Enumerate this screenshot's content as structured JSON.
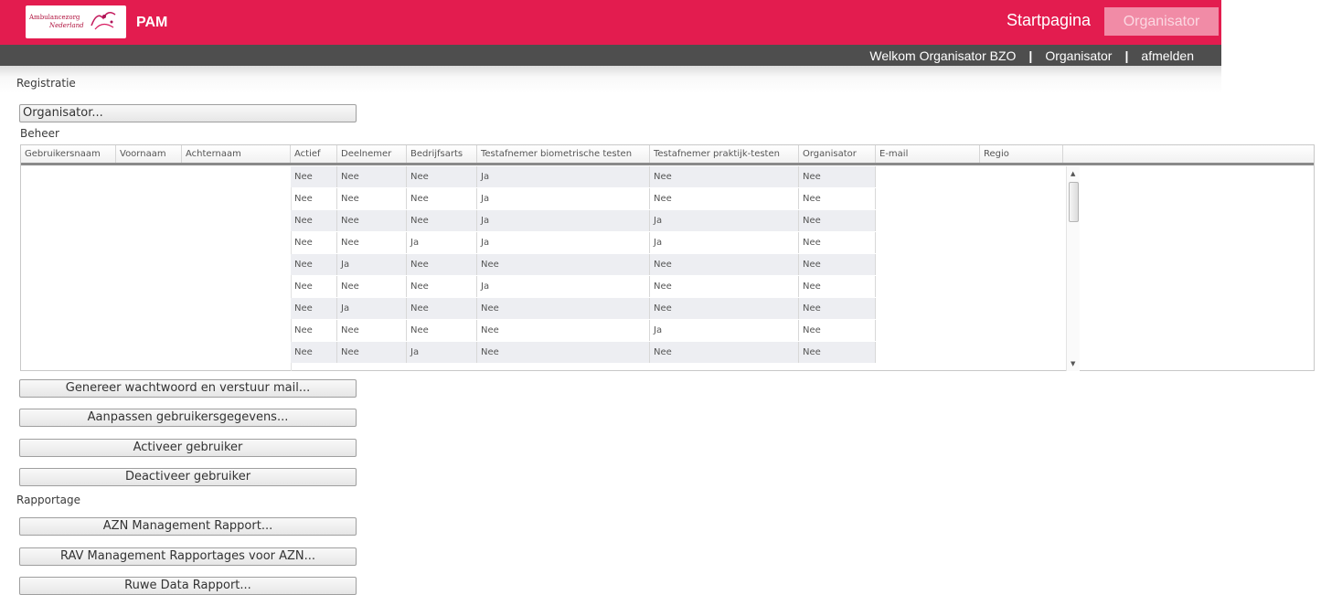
{
  "header": {
    "logo_line1": "Ambulancezorg",
    "logo_line2": "Nederland",
    "app_title": "PAM",
    "startpagina": "Startpagina",
    "role_button": "Organisator",
    "welcome": "Welkom Organisator BZO",
    "role_link": "Organisator",
    "logout": "afmelden",
    "brand_color": "#e31c4f"
  },
  "registratie": {
    "title": "Registratie",
    "organisator_button": "Organisator..."
  },
  "beheer": {
    "title": "Beheer",
    "columns": [
      "Gebruikersnaam",
      "Voornaam",
      "Achternaam",
      "Actief",
      "Deelnemer",
      "Bedrijfsarts",
      "Testafnemer biometrische testen",
      "Testafnemer praktijk-testen",
      "Organisator",
      "E-mail",
      "Regio"
    ],
    "rows": [
      [
        "Nee",
        "Nee",
        "Nee",
        "Ja",
        "Nee",
        "Nee"
      ],
      [
        "Nee",
        "Nee",
        "Nee",
        "Ja",
        "Nee",
        "Nee"
      ],
      [
        "Nee",
        "Nee",
        "Nee",
        "Ja",
        "Ja",
        "Nee"
      ],
      [
        "Nee",
        "Nee",
        "Ja",
        "Ja",
        "Ja",
        "Nee"
      ],
      [
        "Nee",
        "Ja",
        "Nee",
        "Nee",
        "Nee",
        "Nee"
      ],
      [
        "Nee",
        "Nee",
        "Nee",
        "Ja",
        "Nee",
        "Nee"
      ],
      [
        "Nee",
        "Ja",
        "Nee",
        "Nee",
        "Nee",
        "Nee"
      ],
      [
        "Nee",
        "Nee",
        "Nee",
        "Nee",
        "Ja",
        "Nee"
      ],
      [
        "Nee",
        "Nee",
        "Ja",
        "Nee",
        "Nee",
        "Nee"
      ]
    ],
    "buttons": {
      "generate": "Genereer wachtwoord en verstuur mail...",
      "edit": "Aanpassen gebruikersgegevens...",
      "activate": "Activeer gebruiker",
      "deactivate": "Deactiveer gebruiker"
    }
  },
  "rapportage": {
    "title": "Rapportage",
    "buttons": {
      "azn": "AZN Management Rapport...",
      "rav": "RAV Management Rapportages voor AZN...",
      "ruwe": "Ruwe Data Rapport..."
    }
  }
}
